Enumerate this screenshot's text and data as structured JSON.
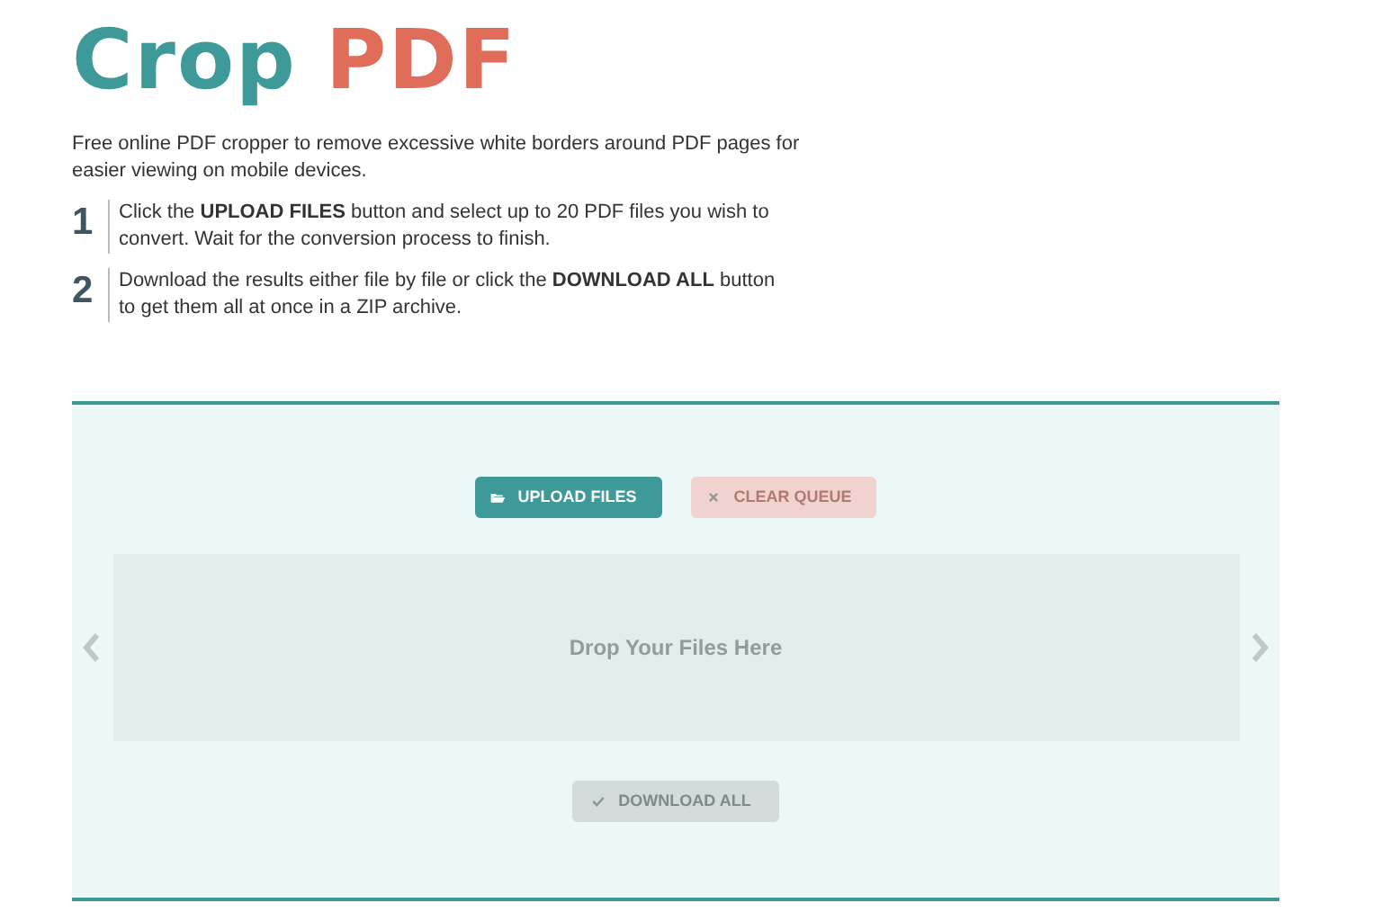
{
  "title": {
    "first": "Crop",
    "second": "PDF"
  },
  "intro": "Free online PDF cropper to remove excessive white borders around PDF pages for easier viewing on mobile devices.",
  "steps": [
    {
      "number": "1",
      "text": "Click the **UPLOAD FILES** button and select up to 20 PDF files you wish to convert. Wait for the conversion process to finish."
    },
    {
      "number": "2",
      "text": "Download the results either file by file or click the **DOWNLOAD ALL** button to get them all at once in a ZIP archive."
    }
  ],
  "toolbar": [
    {
      "kind": "upload",
      "label": "UPLOAD FILES",
      "disabled": false
    },
    {
      "kind": "clear",
      "label": "CLEAR QUEUE",
      "disabled": true
    }
  ],
  "dropzone": {
    "label": "Drop Your Files Here"
  },
  "download_button": {
    "label": "DOWNLOAD ALL",
    "disabled": true
  }
}
